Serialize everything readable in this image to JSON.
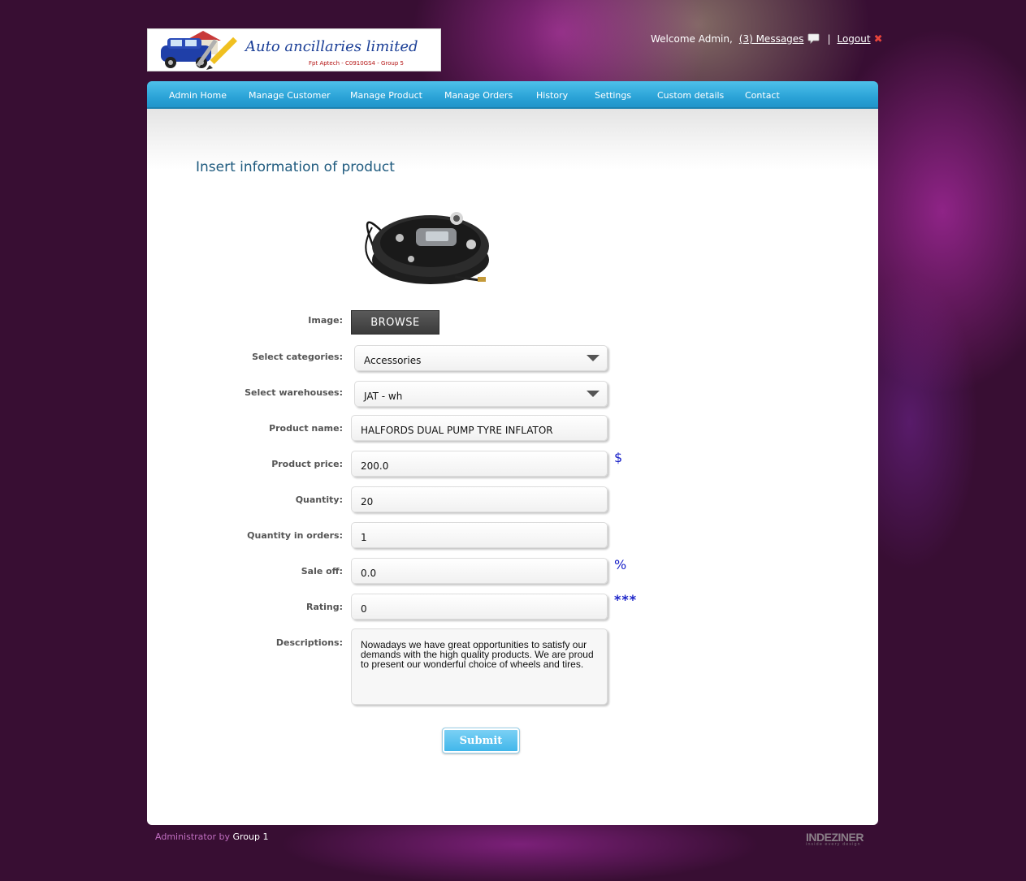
{
  "header": {
    "brand": "Auto ancillaries limited",
    "subtitle": "Fpt Aptech - C0910GS4 - Group 5",
    "welcome": "Welcome Admin,",
    "messages_link": "(3) Messages",
    "separator": "|",
    "logout_link": "Logout"
  },
  "nav": {
    "items": [
      {
        "label": "Admin Home"
      },
      {
        "label": "Manage Customer"
      },
      {
        "label": "Manage Product"
      },
      {
        "label": "Manage Orders"
      },
      {
        "label": "History"
      },
      {
        "label": "Settings"
      },
      {
        "label": "Custom details"
      },
      {
        "label": "Contact"
      }
    ]
  },
  "page": {
    "title": "Insert information of product"
  },
  "form": {
    "image_label": "Image:",
    "browse_label": "BROWSE",
    "category_label": "Select categories:",
    "category_value": "Accessories",
    "warehouse_label": "Select warehouses:",
    "warehouse_value": "JAT - wh",
    "name_label": "Product name:",
    "name_value": "HALFORDS DUAL PUMP TYRE INFLATOR",
    "price_label": "Product price:",
    "price_value": "200.0",
    "price_unit": "$",
    "quantity_label": "Quantity:",
    "quantity_value": "20",
    "qty_orders_label": "Quantity in orders:",
    "qty_orders_value": "1",
    "sale_label": "Sale off:",
    "sale_value": "0.0",
    "sale_unit": "%",
    "rating_label": "Rating:",
    "rating_value": "0",
    "rating_required": "***",
    "desc_label": "Descriptions:",
    "desc_value": "Nowadays we have great opportunities to satisfy our demands with the high quality products. We are proud to present our wonderful choice of wheels and tires.",
    "submit_label": "Submit"
  },
  "footer": {
    "admin_text": "Administrator by",
    "group_text": "Group 1",
    "credit_logo": "INDEZINER",
    "credit_tagline": "inside every design"
  },
  "colors": {
    "background": "#380e33",
    "nav_blue": "#2aa2d6",
    "title_blue": "#1e5a7e",
    "unit_blue": "#1a22c8"
  }
}
